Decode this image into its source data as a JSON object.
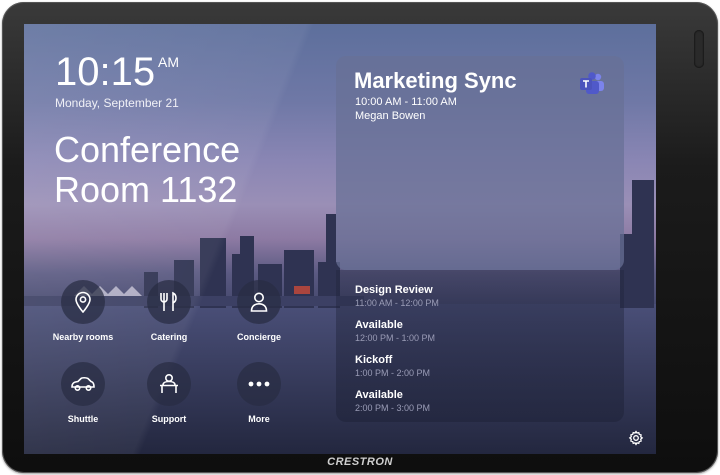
{
  "device": {
    "brand": "CRESTRON"
  },
  "clock": {
    "time": "10:15",
    "ampm": "AM",
    "date": "Monday, September 21"
  },
  "room": {
    "name": "Conference Room 1132"
  },
  "tiles": [
    {
      "label": "Nearby rooms",
      "icon": "location-pin-icon"
    },
    {
      "label": "Catering",
      "icon": "fork-knife-icon"
    },
    {
      "label": "Concierge",
      "icon": "person-icon"
    },
    {
      "label": "Shuttle",
      "icon": "car-icon"
    },
    {
      "label": "Support",
      "icon": "support-desk-icon"
    },
    {
      "label": "More",
      "icon": "more-dots-icon"
    }
  ],
  "current_meeting": {
    "title": "Marketing Sync",
    "time": "10:00 AM - 11:00 AM",
    "organizer": "Megan Bowen",
    "app_icon": "microsoft-teams-icon"
  },
  "agenda": [
    {
      "name": "Design Review",
      "time": "11:00 AM - 12:00 PM"
    },
    {
      "name": "Available",
      "time": "12:00 PM - 1:00 PM"
    },
    {
      "name": "Kickoff",
      "time": "1:00 PM - 2:00 PM"
    },
    {
      "name": "Available",
      "time": "2:00 PM - 3:00 PM"
    }
  ],
  "colors": {
    "accent_teams": "#5b5fc7",
    "text": "#ffffff",
    "muted": "#9a9cb6"
  }
}
